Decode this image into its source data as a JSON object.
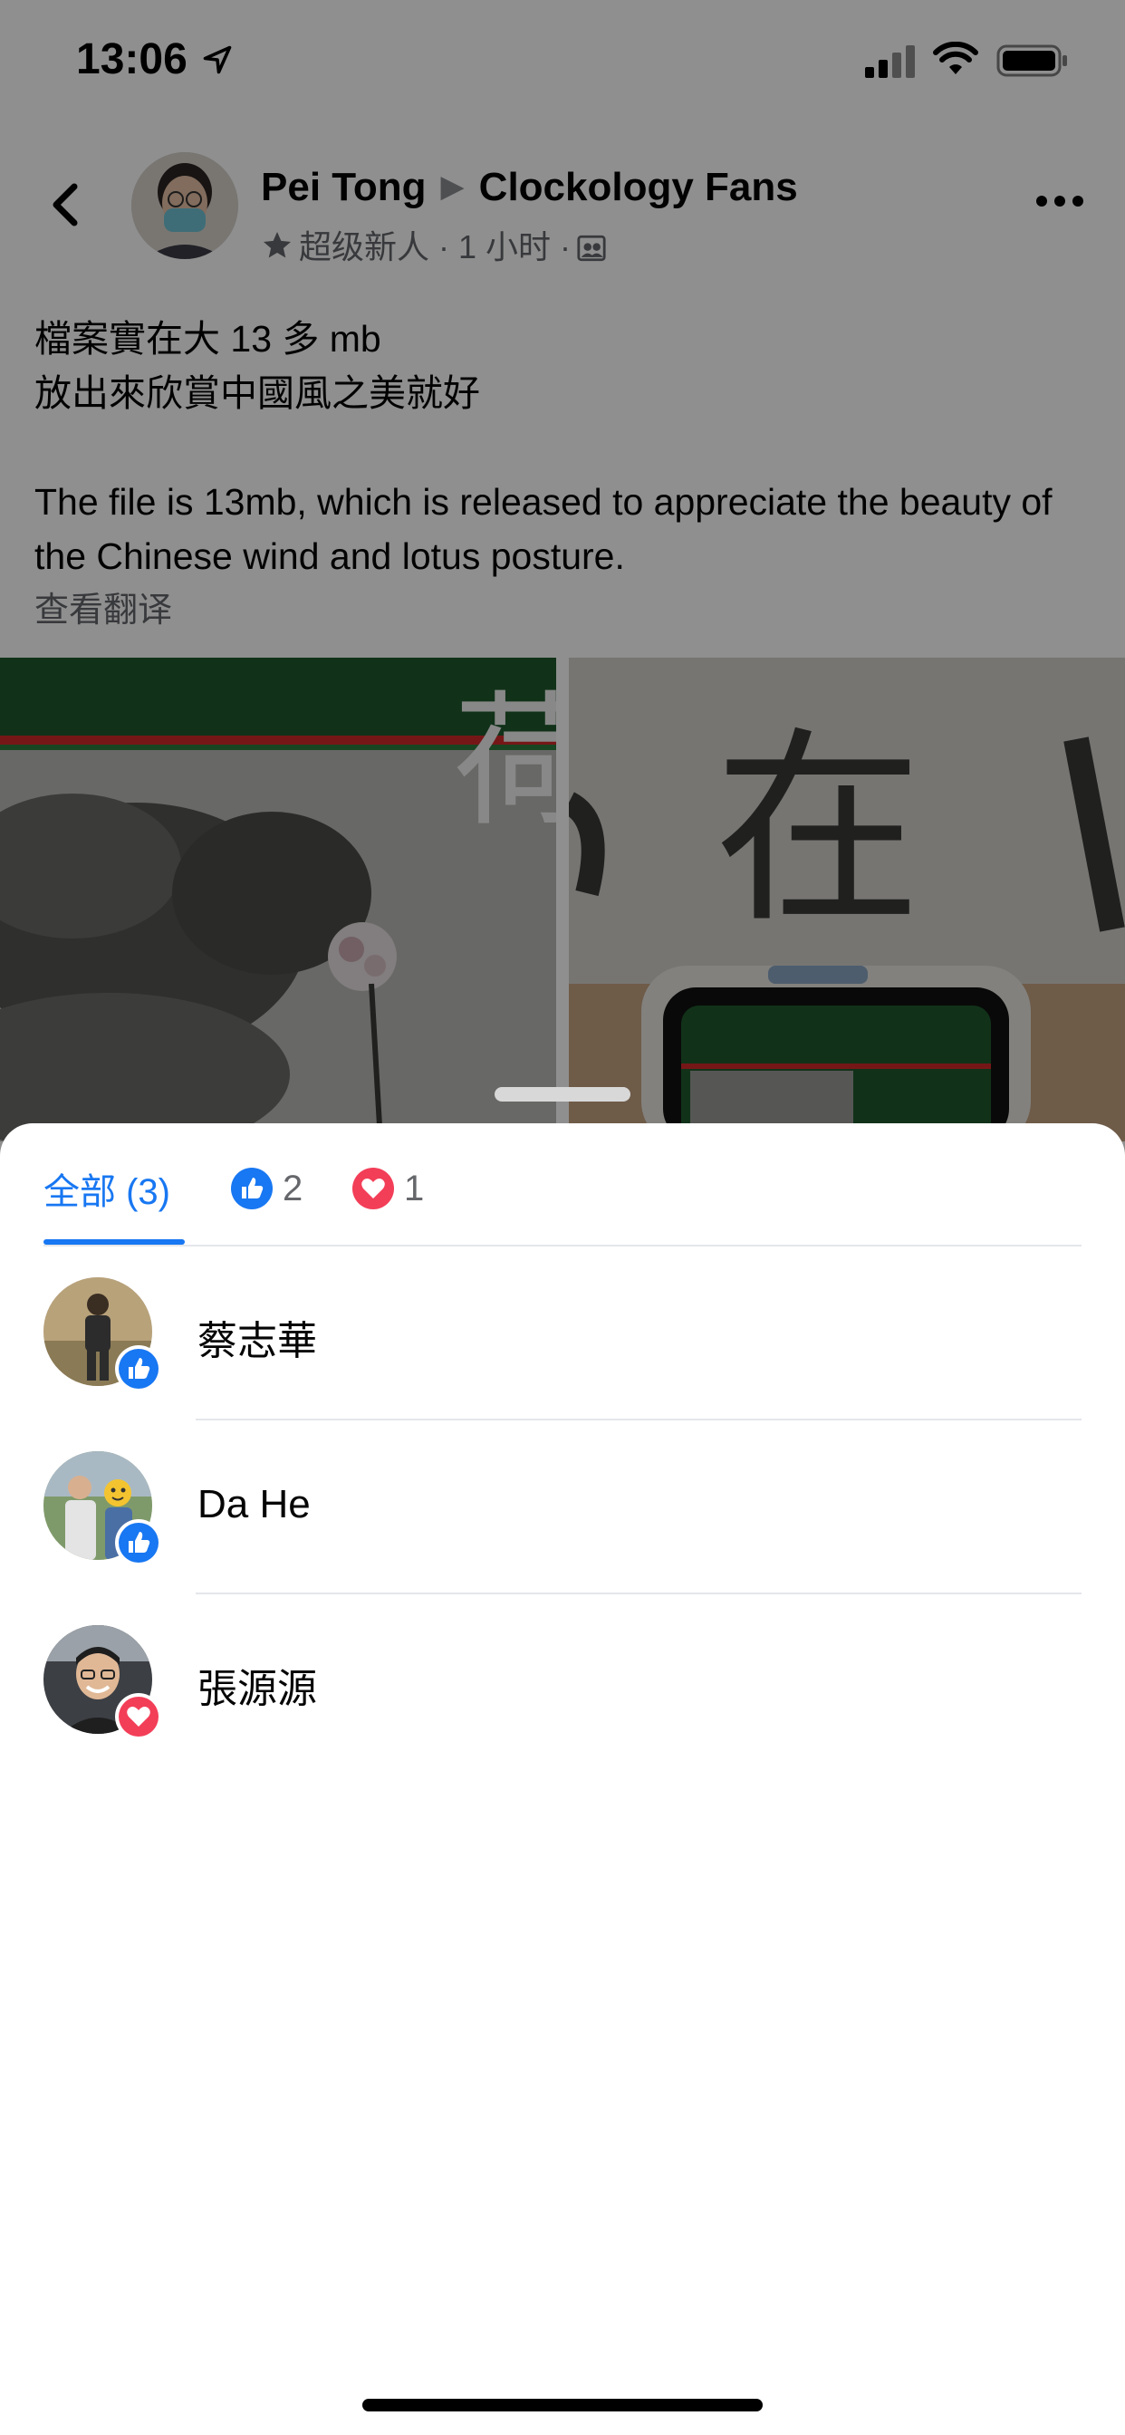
{
  "status_bar": {
    "time": "13:06"
  },
  "post": {
    "author": "Pei Tong",
    "group": "Clockology Fans",
    "meta": "超级新人 · 1 小时 ·",
    "text_zh_line1": "檔案實在大 13 多 mb",
    "text_zh_line2": "放出來欣賞中國風之美就好",
    "text_en": "The file is 13mb, which is released to appreciate the beauty of the Chinese wind and lotus posture.",
    "see_translation": "查看翻译",
    "image_left_char": "荷",
    "image_right_chars": "在"
  },
  "reactions": {
    "tabs": [
      {
        "label": "全部 (3)"
      },
      {
        "count": "2",
        "icon": "like-icon"
      },
      {
        "count": "1",
        "icon": "love-icon"
      }
    ],
    "people": [
      {
        "name": "蔡志華",
        "reaction": "like"
      },
      {
        "name": "Da He",
        "reaction": "like"
      },
      {
        "name": "張源源",
        "reaction": "love"
      }
    ]
  },
  "colors": {
    "accent": "#1877f2",
    "love": "#f33e58",
    "overlay": "rgba(0,0,0,0.44)"
  }
}
